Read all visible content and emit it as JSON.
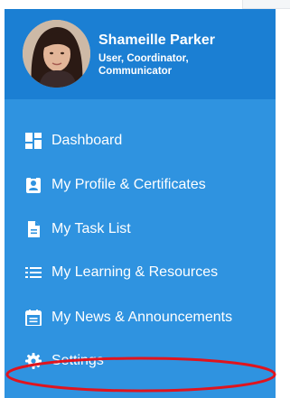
{
  "user": {
    "name": "Shameille Parker",
    "roles": "User, Coordinator, Communicator"
  },
  "menu": {
    "items": [
      {
        "label": "Dashboard",
        "icon": "dashboard-icon"
      },
      {
        "label": "My Profile & Certificates",
        "icon": "id-badge-icon"
      },
      {
        "label": "My Task List",
        "icon": "document-icon"
      },
      {
        "label": "My Learning & Resources",
        "icon": "list-icon"
      },
      {
        "label": "My News & Announcements",
        "icon": "calendar-news-icon"
      },
      {
        "label": "Settings",
        "icon": "gear-icon"
      }
    ]
  },
  "annotation": {
    "highlight_color": "#e0141e",
    "highlighted_item": "My Learning & Resources"
  },
  "colors": {
    "sidebar": "#2f93e0",
    "profile_header": "#1b7fd3",
    "text": "#ffffff"
  }
}
